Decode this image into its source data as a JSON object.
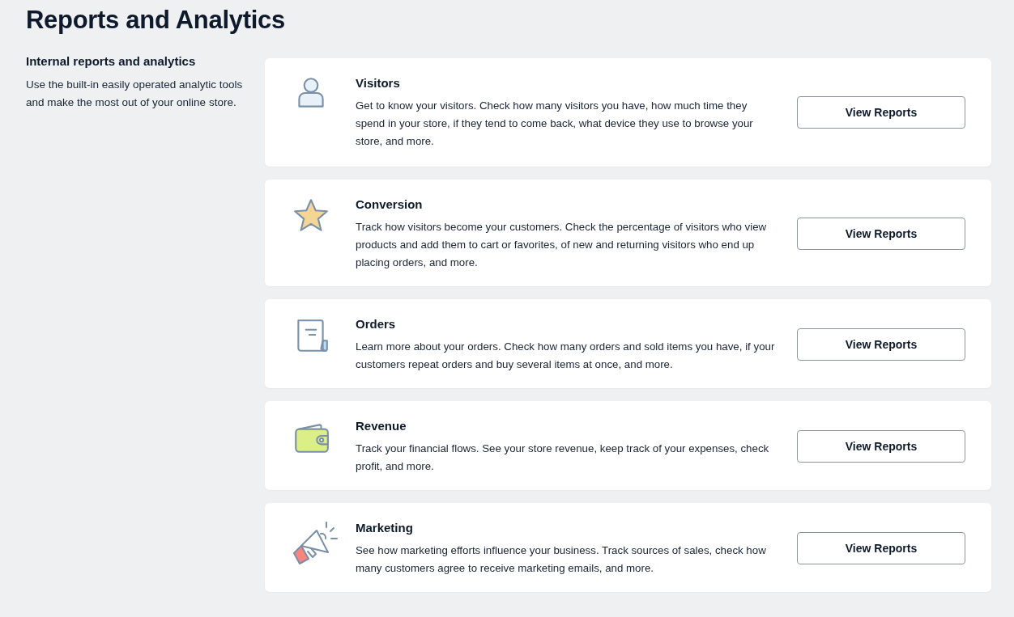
{
  "page": {
    "title": "Reports and Analytics"
  },
  "intro": {
    "heading": "Internal reports and analytics",
    "text": "Use the built-in easily operated analytic tools and make the most out of your online store."
  },
  "cards": [
    {
      "kind": "person",
      "title": "Visitors",
      "text": "Get to know your visitors. Check how many visitors you have, how much time they spend in your store, if they tend to come back, what device they use to browse your store, and more.",
      "button": "View Reports"
    },
    {
      "kind": "star",
      "title": "Conversion",
      "text": "Track how visitors become your customers. Check the percentage of visitors who view products and add them to cart or favorites, of new and returning visitors who end up placing orders, and more.",
      "button": "View Reports"
    },
    {
      "kind": "receipt",
      "title": "Orders",
      "text": "Learn more about your orders. Check how many orders and sold items you have, if your customers repeat orders and buy several items at once, and more.",
      "button": "View Reports"
    },
    {
      "kind": "wallet",
      "title": "Revenue",
      "text": "Track your financial flows. See your store revenue, keep track of your expenses, check profit, and more.",
      "button": "View Reports"
    },
    {
      "kind": "megaphone",
      "title": "Marketing",
      "text": "See how marketing efforts influence your business. Track sources of sales, check how many customers agree to receive marketing emails, and more.",
      "button": "View Reports"
    }
  ]
}
